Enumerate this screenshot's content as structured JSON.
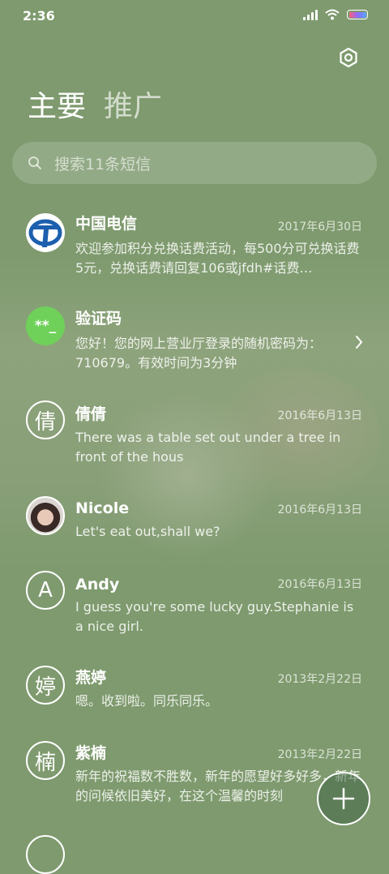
{
  "status_bar": {
    "time": "2:36"
  },
  "tabs": [
    {
      "label": "主要",
      "active": true
    },
    {
      "label": "推广",
      "active": false
    }
  ],
  "search": {
    "placeholder": "搜索11条短信"
  },
  "conversations": [
    {
      "name": "中国电信",
      "date": "2017年6月30日",
      "preview": "欢迎参加积分兑换话费活动，每500分可兑换话费5元，兑换话费请回复106或jfdh#话费…",
      "avatar": "china-telecom-logo-icon"
    },
    {
      "name": "验证码",
      "date": "",
      "preview": "您好！您的网上营业厅登录的随机密码为：710679。有效时间为3分钟",
      "avatar_text": "**_",
      "avatar_color": "#6fd15a"
    },
    {
      "name": "倩倩",
      "date": "2016年6月13日",
      "preview": "There was a table set out under a tree in front of the hous",
      "avatar_text": "倩"
    },
    {
      "name": "Nicole",
      "date": "2016年6月13日",
      "preview": "Let's eat out,shall we?",
      "avatar": "photo-avatar"
    },
    {
      "name": "Andy",
      "date": "2016年6月13日",
      "preview": "I guess you're some lucky guy.Stephanie is a nice girl.",
      "avatar_text": "A"
    },
    {
      "name": "燕婷",
      "date": "2013年2月22日",
      "preview": "嗯。收到啦。同乐同乐。",
      "avatar_text": "婷"
    },
    {
      "name": "紫楠",
      "date": "2013年2月22日",
      "preview": "新年的祝福数不胜数，新年的愿望好多好多，新年的问候依旧美好，在这个温馨的时刻",
      "avatar_text": "楠"
    }
  ],
  "colors": {
    "background": "#7e9a6e",
    "verify_avatar": "#6fd15a",
    "telecom_blue": "#1c5fae"
  }
}
